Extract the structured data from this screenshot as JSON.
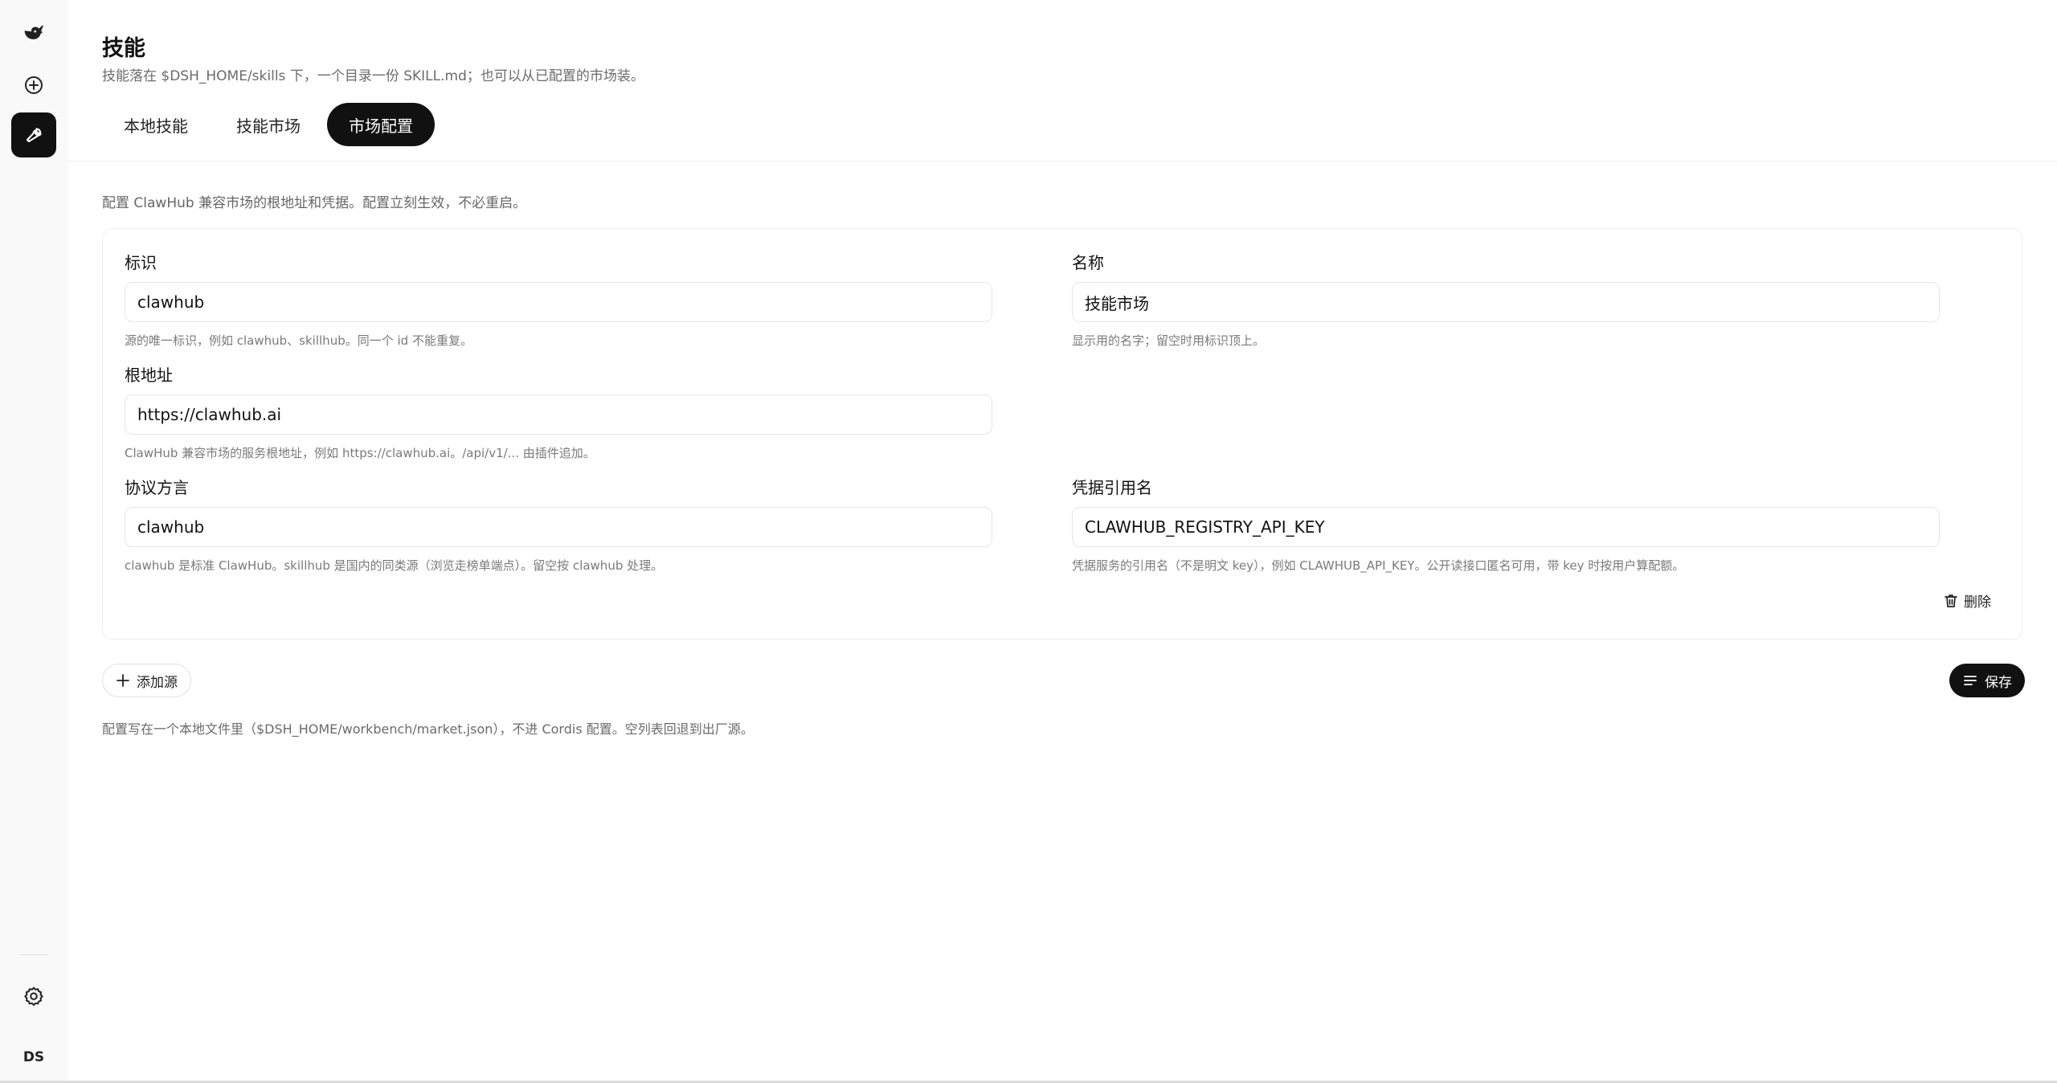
{
  "sidebar": {
    "logo_icon": "whale-logo-icon",
    "new_icon": "plus-circle-icon",
    "skills_icon": "wrench-icon",
    "settings_icon": "gear-icon",
    "avatar_initials": "DS"
  },
  "header": {
    "title": "技能",
    "subtitle": "技能落在 $DSH_HOME/skills 下，一个目录一份 SKILL.md；也可以从已配置的市场装。"
  },
  "tabs": [
    {
      "label": "本地技能",
      "active": false
    },
    {
      "label": "技能市场",
      "active": false
    },
    {
      "label": "市场配置",
      "active": true
    }
  ],
  "intro": "配置 ClawHub 兼容市场的根地址和凭据。配置立刻生效，不必重启。",
  "source": {
    "id": {
      "label": "标识",
      "value": "clawhub",
      "hint": "源的唯一标识，例如 clawhub、skillhub。同一个 id 不能重复。"
    },
    "name": {
      "label": "名称",
      "value": "技能市场",
      "hint": "显示用的名字；留空时用标识顶上。"
    },
    "base_url": {
      "label": "根地址",
      "value": "https://clawhub.ai",
      "hint": "ClawHub 兼容市场的服务根地址，例如 https://clawhub.ai。/api/v1/... 由插件追加。"
    },
    "dialect": {
      "label": "协议方言",
      "value": "clawhub",
      "hint": "clawhub 是标准 ClawHub。skillhub 是国内的同类源（浏览走榜单端点）。留空按 clawhub 处理。"
    },
    "credential": {
      "label": "凭据引用名",
      "value": "CLAWHUB_REGISTRY_API_KEY",
      "hint": "凭据服务的引用名（不是明文 key），例如 CLAWHUB_API_KEY。公开读接口匿名可用，带 key 时按用户算配额。"
    },
    "delete_label": "删除",
    "delete_icon": "trash-icon"
  },
  "actions": {
    "add_source_label": "添加源",
    "add_icon": "plus-icon",
    "save_label": "保存",
    "save_icon": "list-icon"
  },
  "footer_note": "配置写在一个本地文件里（$DSH_HOME/workbench/market.json），不进 Cordis 配置。空列表回退到出厂源。"
}
